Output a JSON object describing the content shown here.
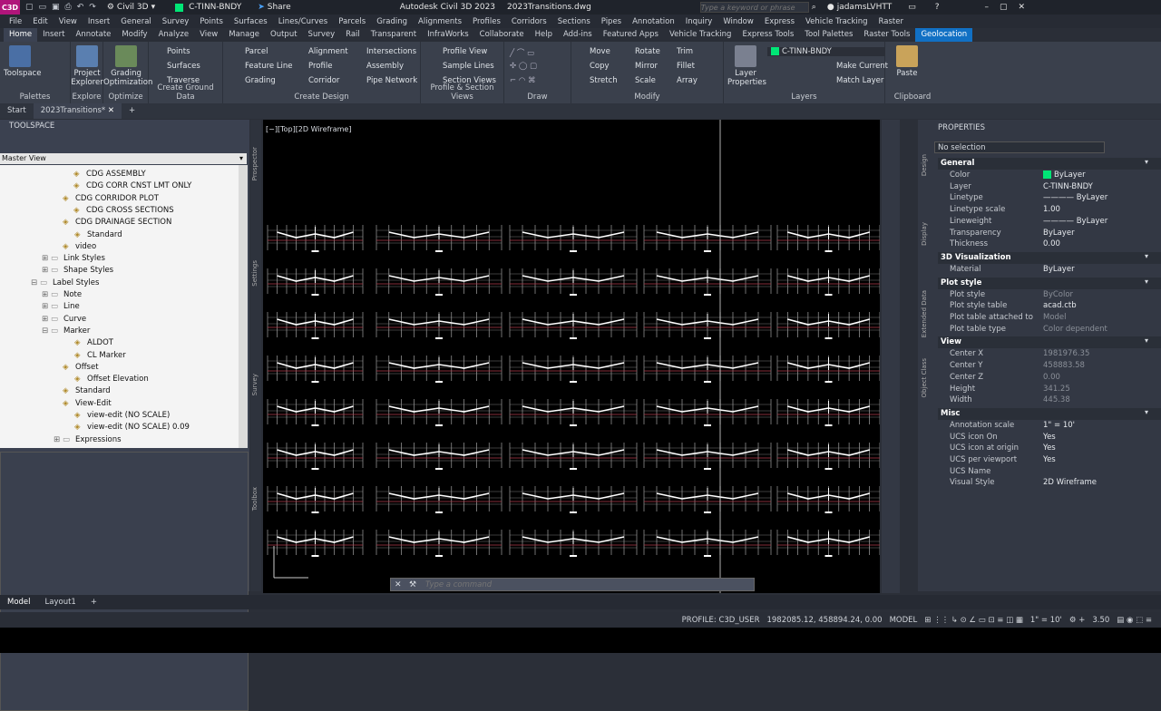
{
  "app": {
    "title": "Autodesk Civil 3D 2023",
    "file": "2023Transitions.dwg",
    "workspace": "Civil 3D",
    "layer_qa": "C-TINN-BNDY",
    "share": "Share",
    "search_placeholder": "Type a keyword or phrase",
    "user": "jadamsLVHTT",
    "appicon": "C3D"
  },
  "menu": [
    "File",
    "Edit",
    "View",
    "Insert",
    "General",
    "Survey",
    "Points",
    "Surfaces",
    "Lines/Curves",
    "Parcels",
    "Grading",
    "Alignments",
    "Profiles",
    "Corridors",
    "Sections",
    "Pipes",
    "Annotation",
    "Inquiry",
    "Window",
    "Express",
    "Vehicle Tracking",
    "Raster"
  ],
  "tabs": [
    "Home",
    "Insert",
    "Annotate",
    "Modify",
    "Analyze",
    "View",
    "Manage",
    "Output",
    "Survey",
    "Rail",
    "Transparent",
    "InfraWorks",
    "Collaborate",
    "Help",
    "Add-ins",
    "Featured Apps",
    "Vehicle Tracking",
    "Express Tools",
    "Tool Palettes",
    "Raster Tools",
    "Geolocation"
  ],
  "ribbon": {
    "palettes": {
      "toolspace": "Toolspace",
      "title": "Palettes"
    },
    "explore": {
      "project_explorer": "Project Explorer",
      "title": "Explore"
    },
    "optimize": {
      "grading_opt": "Grading Optimization",
      "title": "Optimize"
    },
    "ground": {
      "points": "Points",
      "surfaces": "Surfaces",
      "traverse": "Traverse",
      "title": "Create Ground Data"
    },
    "design": {
      "parcel": "Parcel",
      "feature_line": "Feature Line",
      "grading": "Grading",
      "alignment": "Alignment",
      "profile": "Profile",
      "corridor": "Corridor",
      "intersections": "Intersections",
      "assembly": "Assembly",
      "pipe_network": "Pipe Network",
      "title": "Create Design"
    },
    "profile_section": {
      "profile_view": "Profile View",
      "sample_lines": "Sample Lines",
      "section_views": "Section Views",
      "title": "Profile & Section Views"
    },
    "draw": {
      "title": "Draw"
    },
    "modify": {
      "move": "Move",
      "rotate": "Rotate",
      "trim": "Trim",
      "copy": "Copy",
      "mirror": "Mirror",
      "fillet": "Fillet",
      "stretch": "Stretch",
      "scale": "Scale",
      "array": "Array",
      "title": "Modify"
    },
    "layers": {
      "layer_properties": "Layer Properties",
      "current": "C-TINN-BNDY",
      "make_current": "Make Current",
      "match_layer": "Match Layer",
      "title": "Layers"
    },
    "clipboard": {
      "paste": "Paste",
      "title": "Clipboard"
    }
  },
  "doctabs": {
    "start": "Start",
    "current": "2023Transitions*"
  },
  "toolspace": {
    "title": "TOOLSPACE",
    "view": "Master View",
    "tree": [
      {
        "label": "CDG ASSEMBLY",
        "indent": 95,
        "icon": "style-icon"
      },
      {
        "label": "CDG CORR CNST LMT ONLY",
        "indent": 95,
        "icon": "style-icon"
      },
      {
        "label": "CDG CORRIDOR PLOT",
        "indent": 83,
        "icon": "style-icon"
      },
      {
        "label": "CDG CROSS SECTIONS",
        "indent": 95,
        "icon": "style-icon"
      },
      {
        "label": "CDG DRAINAGE SECTION",
        "indent": 83,
        "icon": "style-icon"
      },
      {
        "label": "Standard",
        "indent": 96,
        "icon": "style-icon"
      },
      {
        "label": "video",
        "indent": 83,
        "icon": "style-icon"
      },
      {
        "label": "Link Styles",
        "indent": 70,
        "icon": "folder-icon",
        "exp": "+"
      },
      {
        "label": "Shape Styles",
        "indent": 70,
        "icon": "folder-icon",
        "exp": "+"
      },
      {
        "label": "Label Styles",
        "indent": 58,
        "icon": "folder-icon",
        "exp": "-"
      },
      {
        "label": "Note",
        "indent": 70,
        "icon": "folder-icon",
        "exp": "+"
      },
      {
        "label": "Line",
        "indent": 70,
        "icon": "folder-icon",
        "exp": "+"
      },
      {
        "label": "Curve",
        "indent": 70,
        "icon": "folder-icon",
        "exp": "+"
      },
      {
        "label": "Marker",
        "indent": 70,
        "icon": "folder-icon",
        "exp": "-"
      },
      {
        "label": "ALDOT",
        "indent": 96,
        "icon": "style-icon"
      },
      {
        "label": "CL Marker",
        "indent": 96,
        "icon": "style-icon"
      },
      {
        "label": "Offset",
        "indent": 83,
        "icon": "style-icon"
      },
      {
        "label": "Offset Elevation",
        "indent": 96,
        "icon": "style-icon"
      },
      {
        "label": "Standard",
        "indent": 83,
        "icon": "style-icon"
      },
      {
        "label": "View-Edit",
        "indent": 83,
        "icon": "style-icon"
      },
      {
        "label": "view-edit (NO SCALE)",
        "indent": 96,
        "icon": "style-icon"
      },
      {
        "label": "view-edit (NO SCALE) 0.09",
        "indent": 96,
        "icon": "style-icon"
      },
      {
        "label": "Expressions",
        "indent": 83,
        "icon": "folder-icon",
        "exp": "+"
      }
    ],
    "side_tabs": [
      "Prospector",
      "Settings",
      "Survey",
      "Toolbox"
    ]
  },
  "viewport": {
    "label": "[−][Top][2D Wireframe]"
  },
  "properties": {
    "title": "PROPERTIES",
    "selection": "No selection",
    "side_tabs": [
      "Design",
      "Display",
      "Extended Data",
      "Object Class"
    ],
    "sections": [
      {
        "name": "General",
        "rows": [
          [
            "Color",
            "ByLayer"
          ],
          [
            "Layer",
            "C-TINN-BNDY"
          ],
          [
            "Linetype",
            "———— ByLayer"
          ],
          [
            "Linetype scale",
            "1.00"
          ],
          [
            "Lineweight",
            "———— ByLayer"
          ],
          [
            "Transparency",
            "ByLayer"
          ],
          [
            "Thickness",
            "0.00"
          ]
        ]
      },
      {
        "name": "3D Visualization",
        "rows": [
          [
            "Material",
            "ByLayer"
          ]
        ]
      },
      {
        "name": "Plot style",
        "rows": [
          [
            "Plot style",
            "ByColor"
          ],
          [
            "Plot style table",
            "acad.ctb"
          ],
          [
            "Plot table attached to",
            "Model"
          ],
          [
            "Plot table type",
            "Color dependent"
          ]
        ]
      },
      {
        "name": "View",
        "rows": [
          [
            "Center X",
            "1981976.35"
          ],
          [
            "Center Y",
            "458883.58"
          ],
          [
            "Center Z",
            "0.00"
          ],
          [
            "Height",
            "341.25"
          ],
          [
            "Width",
            "445.38"
          ]
        ]
      },
      {
        "name": "Misc",
        "rows": [
          [
            "Annotation scale",
            "1\" = 10'"
          ],
          [
            "UCS icon On",
            "Yes"
          ],
          [
            "UCS icon at origin",
            "Yes"
          ],
          [
            "UCS per viewport",
            "Yes"
          ],
          [
            "UCS Name",
            ""
          ],
          [
            "Visual Style",
            "2D Wireframe"
          ]
        ]
      }
    ],
    "color_accent": "#00e676"
  },
  "command": {
    "placeholder": "Type a command"
  },
  "layout_tabs": [
    "Model",
    "Layout1"
  ],
  "status": {
    "profile": "PROFILE: C3D_USER",
    "coords": "1982085.12, 458894.24, 0.00",
    "model": "MODEL",
    "scale": "1\" = 10'",
    "value": "3.50"
  }
}
